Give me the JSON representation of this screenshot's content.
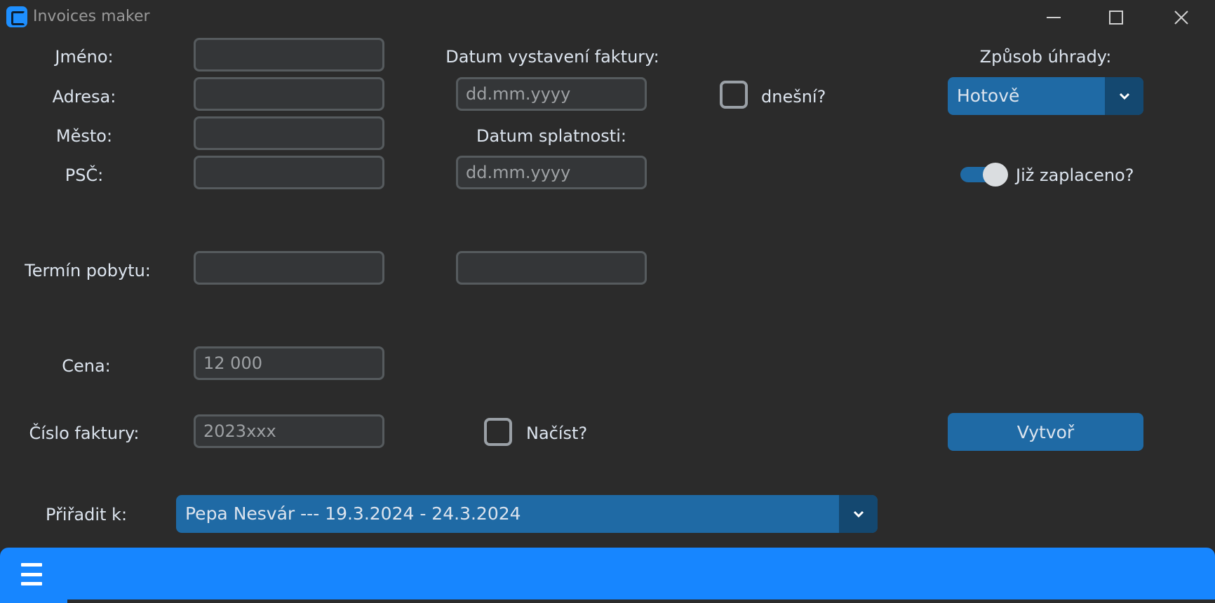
{
  "window": {
    "title": "Invoices maker"
  },
  "form": {
    "jmeno_label": "Jméno:",
    "adresa_label": "Adresa:",
    "mesto_label": "Město:",
    "psc_label": "PSČ:",
    "termin_label": "Termín pobytu:",
    "cena_label": "Cena:",
    "cislo_label": "Číslo faktury:",
    "priradit_label": "Přiřadit k:",
    "datum_vystaveni_label": "Datum vystavení faktury:",
    "datum_splatnosti_label": "Datum splatnosti:",
    "date_placeholder": "dd.mm.yyyy",
    "cena_placeholder": "12 000",
    "cislo_placeholder": "2023xxx",
    "dnesni_label": "dnešní?",
    "nacist_label": "Načíst?",
    "zpusob_label": "Způsob úhrady:",
    "zpusob_value": "Hotově",
    "zaplaceno_label": "Již zaplaceno?",
    "zaplaceno_on": true,
    "vytvor_label": "Vytvoř",
    "priradit_value": "Pepa Nesvár --- 19.3.2024 - 24.3.2024"
  },
  "colors": {
    "background": "#2b2b2b",
    "accent": "#1f6aa5",
    "accent_dark": "#144870",
    "bottom_bar": "#1786ff"
  }
}
